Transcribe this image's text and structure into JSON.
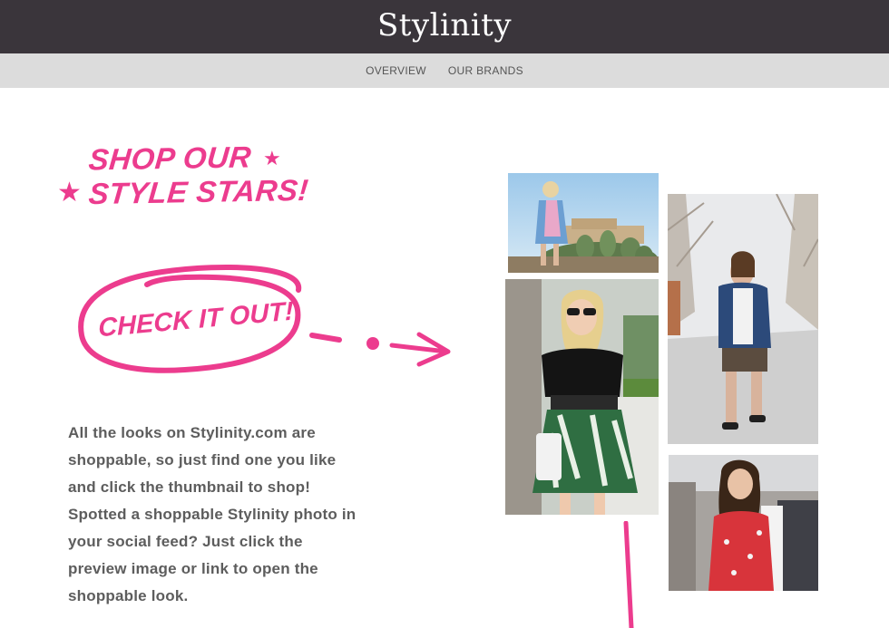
{
  "header": {
    "logo": "Stylinity"
  },
  "nav": {
    "items": [
      {
        "label": "OVERVIEW"
      },
      {
        "label": "OUR BRANDS"
      }
    ]
  },
  "hero": {
    "headline_line1": "SHOP OUR",
    "headline_line2": "STYLE STARS!",
    "cta_label": "CHECK IT OUT!",
    "body": "All the looks on Stylinity.com are shoppable, so just find one you like and click the thumbnail to shop! Spotted a shoppable Stylinity photo in your social feed? Just click the preview image or link to open the shoppable look."
  },
  "colors": {
    "accent": "#ec3c8e",
    "header_bg": "#3a353b",
    "nav_bg": "#dcdcdc",
    "body_text": "#5d5d5d"
  },
  "photos": [
    {
      "name": "look-photo-cactus"
    },
    {
      "name": "look-photo-palm-skirt"
    },
    {
      "name": "look-photo-denim-jacket"
    },
    {
      "name": "look-photo-red-dress"
    }
  ]
}
